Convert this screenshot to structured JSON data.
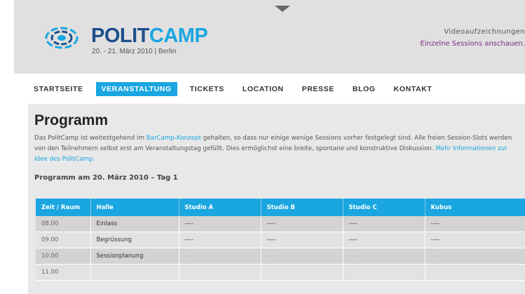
{
  "header": {
    "logo_part1": "POLIT",
    "logo_part2": "CAMP",
    "logo_sub": "20. - 21. März 2010 | Berlin",
    "right_line1": "Videoaufzeichnungen",
    "right_link": "Einzelne Sessions anschauen."
  },
  "colors": {
    "accent": "#1aa6e0",
    "brand_dark": "#1d4f8c",
    "link_purple": "#7b2a87"
  },
  "nav": {
    "items": [
      "STARTSEITE",
      "VERANSTALTUNG",
      "TICKETS",
      "LOCATION",
      "PRESSE",
      "BLOG",
      "KONTAKT"
    ],
    "active": "VERANSTALTUNG"
  },
  "content": {
    "title": "Programm",
    "intro_1": "Das PolitCamp ist weitestgehend im ",
    "intro_link1": "BarCamp-Konzept",
    "intro_2": " gehalten, so dass nur einige wenige Sessions vorher festgelegt sind. Alle freien Session-Slots werden von den Teilnehmern selbst erst am Veranstaltungstag gefüllt. Dies ermöglichst eine breite, spontane und konstruktive Diskussion. ",
    "intro_link2": "Mehr Informationen zur Idee des PolitCamp.",
    "subtitle": "Programm am 20. März 2010 – Tag 1"
  },
  "table": {
    "headers": [
      "Zeit / Raum",
      "Halle",
      "Studio A",
      "Studio B",
      "Studio C",
      "Kubus"
    ],
    "rows": [
      [
        "08.00",
        "Einlass",
        "----",
        "----",
        "----",
        "----"
      ],
      [
        "09.00",
        "Begrüssung",
        "----",
        "----",
        "----",
        "----"
      ],
      [
        "10.00",
        "Sessionplanung",
        "----",
        "----",
        "----",
        "----"
      ],
      [
        "11.00",
        "",
        "",
        "",
        "",
        ""
      ]
    ]
  }
}
